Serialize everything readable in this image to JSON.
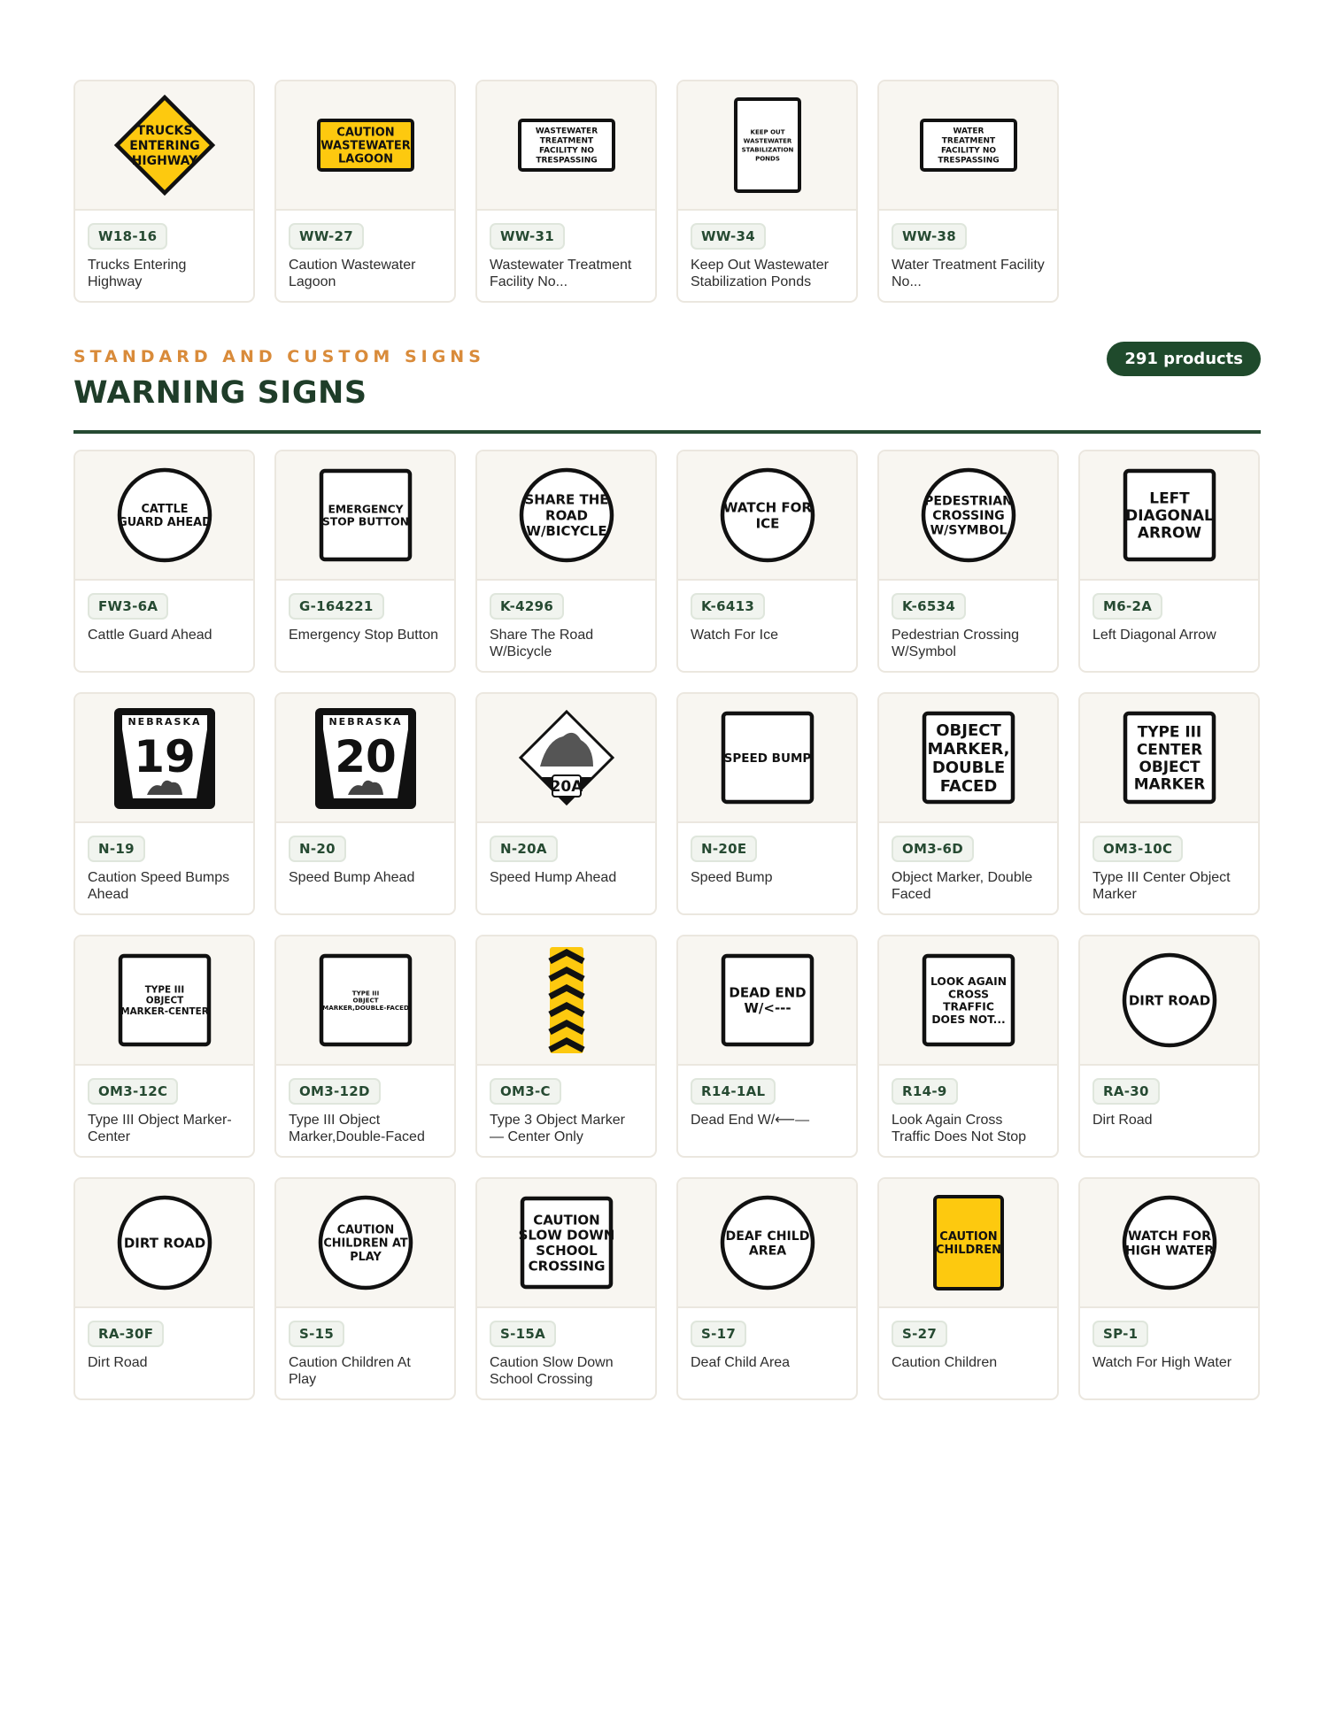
{
  "top_products": [
    {
      "code": "W18-16",
      "title": "Trucks Entering Highway",
      "shape": "diamond-yellow",
      "lines": [
        "TRUCKS",
        "ENTERING",
        "HIGHWAY"
      ]
    },
    {
      "code": "WW-27",
      "title": "Caution Wastewater Lagoon",
      "shape": "rect-yellow",
      "lines": [
        "CAUTION",
        "WASTEWATER",
        "LAGOON"
      ]
    },
    {
      "code": "WW-31",
      "title": "Wastewater Treatment Facility No...",
      "shape": "rect-white-wide",
      "lines": [
        "WASTEWATER",
        "TREATMENT",
        "FACILITY NO",
        "TRESPASSING"
      ]
    },
    {
      "code": "WW-34",
      "title": "Keep Out Wastewater Stabilization Ponds",
      "shape": "rect-white-tall",
      "lines": [
        "KEEP OUT",
        "WASTEWATER",
        "STABILIZATION",
        "PONDS"
      ]
    },
    {
      "code": "WW-38",
      "title": "Water Treatment Facility No...",
      "shape": "rect-white-wide",
      "lines": [
        "WATER",
        "TREATMENT",
        "FACILITY NO",
        "TRESPASSING"
      ]
    }
  ],
  "section": {
    "eyebrow": "STANDARD AND CUSTOM SIGNS",
    "heading": "WARNING SIGNS",
    "count": "291 products"
  },
  "products": [
    {
      "code": "FW3-6A",
      "title": "Cattle Guard Ahead",
      "shape": "circle",
      "lines": [
        "CATTLE",
        "GUARD AHEAD"
      ]
    },
    {
      "code": "G-164221",
      "title": "Emergency Stop Button",
      "shape": "rect-white",
      "lines": [
        "EMERGENCY",
        "STOP BUTTON"
      ]
    },
    {
      "code": "K-4296",
      "title": "Share The Road W/Bicycle",
      "shape": "circle",
      "lines": [
        "SHARE THE",
        "ROAD",
        "W/BICYCLE"
      ]
    },
    {
      "code": "K-6413",
      "title": "Watch For Ice",
      "shape": "circle",
      "lines": [
        "WATCH FOR",
        "ICE"
      ]
    },
    {
      "code": "K-6534",
      "title": "Pedestrian Crossing W/Symbol",
      "shape": "circle",
      "lines": [
        "PEDESTRIAN",
        "CROSSING",
        "W/SYMBOL"
      ]
    },
    {
      "code": "M6-2A",
      "title": "Left Diagonal Arrow",
      "shape": "rect-white",
      "lines": [
        "LEFT",
        "DIAGONAL",
        "ARROW"
      ]
    },
    {
      "code": "N-19",
      "title": "Caution Speed Bumps Ahead",
      "shape": "route",
      "lines": [
        "NEBRASKA",
        "19"
      ]
    },
    {
      "code": "N-20",
      "title": "Speed Bump Ahead",
      "shape": "route",
      "lines": [
        "NEBRASKA",
        "20"
      ]
    },
    {
      "code": "N-20A",
      "title": "Speed Hump Ahead",
      "shape": "diamond-route",
      "lines": [
        "20A"
      ]
    },
    {
      "code": "N-20E",
      "title": "Speed Bump",
      "shape": "rect-white",
      "lines": [
        "SPEED BUMP"
      ]
    },
    {
      "code": "OM3-6D",
      "title": "Object Marker, Double Faced",
      "shape": "rect-white",
      "lines": [
        "OBJECT",
        "MARKER,",
        "DOUBLE",
        "FACED"
      ]
    },
    {
      "code": "OM3-10C",
      "title": "Type III Center Object Marker",
      "shape": "rect-white",
      "lines": [
        "TYPE III",
        "CENTER",
        "OBJECT",
        "MARKER"
      ]
    },
    {
      "code": "OM3-12C",
      "title": "Type III Object Marker-Center",
      "shape": "rect-white",
      "lines": [
        "TYPE III",
        "OBJECT",
        "MARKER-CENTER"
      ]
    },
    {
      "code": "OM3-12D",
      "title": "Type III Object Marker,Double-Faced",
      "shape": "rect-white",
      "lines": [
        "TYPE III",
        "OBJECT",
        "MARKER,DOUBLE-FACED"
      ]
    },
    {
      "code": "OM3-C",
      "title": "Type 3 Object Marker — Center Only",
      "shape": "chevron",
      "lines": []
    },
    {
      "code": "R14-1AL",
      "title": "Dead End W/⟵—",
      "shape": "rect-white",
      "lines": [
        "DEAD END",
        "W/<---"
      ]
    },
    {
      "code": "R14-9",
      "title": "Look Again Cross Traffic Does Not Stop",
      "shape": "rect-white",
      "lines": [
        "LOOK AGAIN",
        "CROSS",
        "TRAFFIC",
        "DOES NOT..."
      ]
    },
    {
      "code": "RA-30",
      "title": "Dirt Road",
      "shape": "circle",
      "lines": [
        "DIRT ROAD"
      ]
    },
    {
      "code": "RA-30F",
      "title": "Dirt Road",
      "shape": "circle",
      "lines": [
        "DIRT ROAD"
      ]
    },
    {
      "code": "S-15",
      "title": "Caution Children At Play",
      "shape": "circle",
      "lines": [
        "CAUTION",
        "CHILDREN AT",
        "PLAY"
      ]
    },
    {
      "code": "S-15A",
      "title": "Caution Slow Down School Crossing",
      "shape": "rect-white",
      "lines": [
        "CAUTION",
        "SLOW DOWN",
        "SCHOOL",
        "CROSSING"
      ]
    },
    {
      "code": "S-17",
      "title": "Deaf Child Area",
      "shape": "circle",
      "lines": [
        "DEAF CHILD",
        "AREA"
      ]
    },
    {
      "code": "S-27",
      "title": "Caution Children",
      "shape": "rect-yellow-tall",
      "lines": [
        "CAUTION",
        "CHILDREN"
      ]
    },
    {
      "code": "SP-1",
      "title": "Watch For High Water",
      "shape": "circle",
      "lines": [
        "WATCH FOR",
        "HIGH WATER"
      ]
    }
  ],
  "colors": {
    "accent": "#d98b3a",
    "brand": "#1f4a2c",
    "sign_yellow": "#fdc90f"
  }
}
